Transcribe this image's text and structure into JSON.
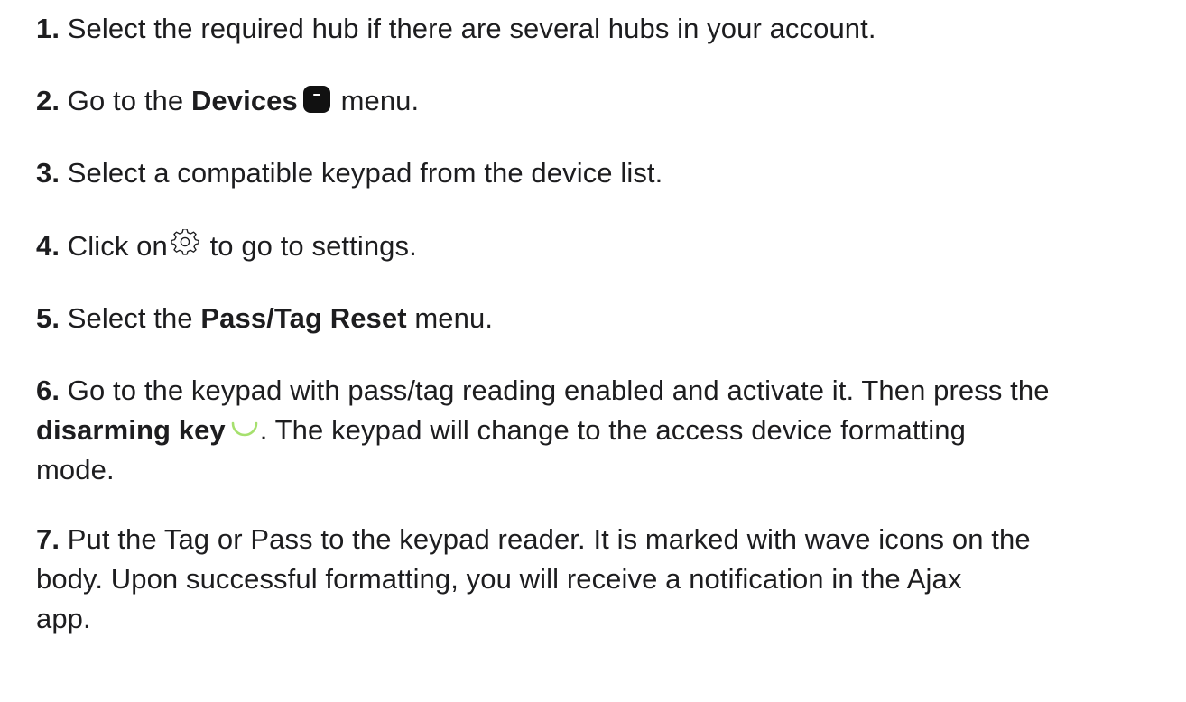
{
  "steps": [
    {
      "number": "1.",
      "text": "Select the required hub if there are several hubs in your account."
    },
    {
      "number": "2.",
      "pre": "Go to the",
      "bold": "Devices",
      "post": "menu.",
      "icon": "devices-icon"
    },
    {
      "number": "3.",
      "text": "Select a compatible keypad from the device list."
    },
    {
      "number": "4.",
      "pre": "Click on",
      "post": "to go to settings.",
      "icon": "gear-icon"
    },
    {
      "number": "5.",
      "pre": "Select the",
      "bold": "Pass/Tag Reset",
      "post": "menu."
    },
    {
      "number": "6.",
      "line1": "Go to the keypad with pass/tag reading enabled and activate it. Then press the",
      "bold": "disarming key",
      "post": ". The keypad will change to the access device formatting",
      "line3": "mode.",
      "icon": "disarm-key-icon"
    },
    {
      "number": "7.",
      "line1": "Put the Tag or Pass to the keypad reader. It is marked with wave icons on the",
      "line2": "body. Upon successful formatting, you will receive a notification in the Ajax",
      "line3": "app."
    }
  ],
  "colors": {
    "text": "#1d1d1f",
    "devices_icon": "#111111",
    "disarm_icon": "#a6e06e"
  }
}
